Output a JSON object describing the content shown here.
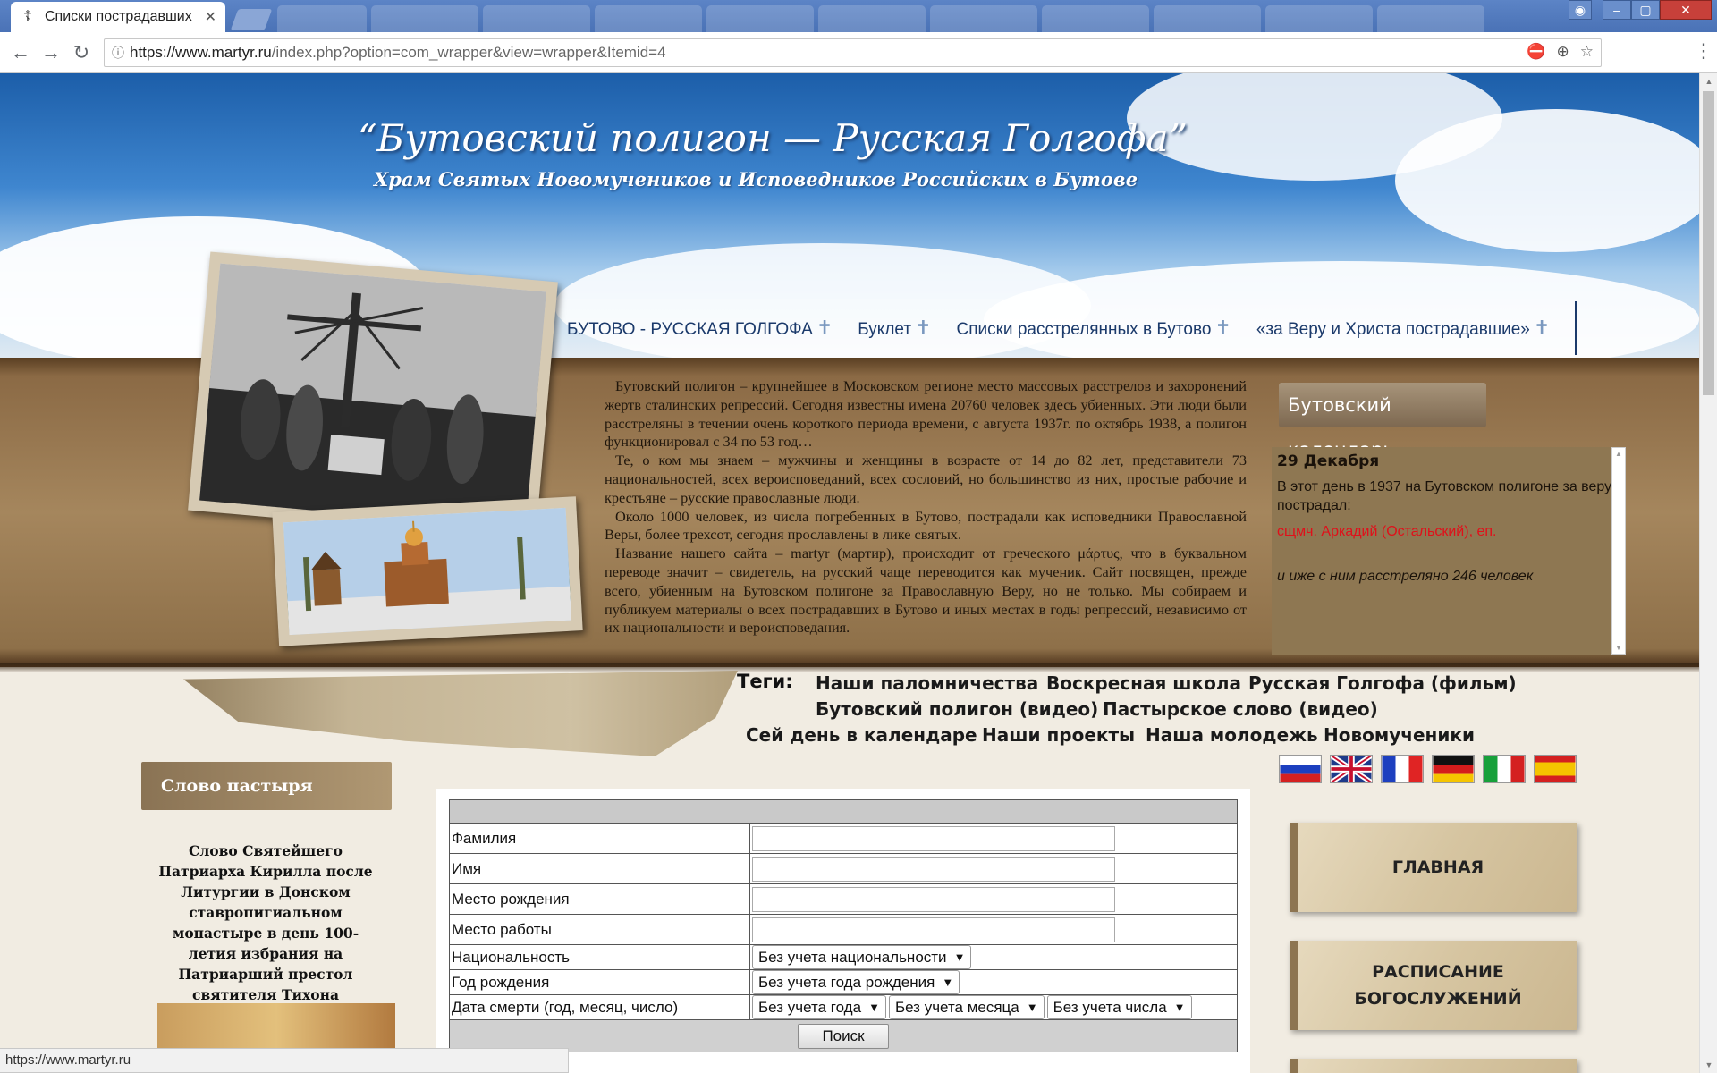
{
  "browser": {
    "tab_title": "Списки пострадавших",
    "url_host": "https://www.martyr.ru",
    "url_path": "/index.php?option=com_wrapper&view=wrapper&Itemid=4",
    "status_url": "https://www.martyr.ru"
  },
  "header": {
    "title": "“Бутовский полигон — Русская Голгофа”",
    "subtitle": "Храм Святых Новомучеников и Исповедников Российских в Бутове"
  },
  "nav": {
    "items": [
      {
        "label": "БУТОВО - РУССКАЯ ГОЛГОФА"
      },
      {
        "label": "Буклет"
      },
      {
        "label": "Списки расстрелянных в Бутово"
      },
      {
        "label": "«за Веру и Христа пострадавшие»"
      }
    ]
  },
  "intro": {
    "paragraphs": [
      "Бутовский полигон – крупнейшее в Московском регионе место массовых расстрелов и захоронений жертв сталинских репрессий. Сегодня известны имена 20760 человек здесь убиенных. Эти люди были расстреляны в течении очень короткого периода времени, с августа 1937г. по октябрь 1938, а полигон функционировал с 34 по 53 год…",
      "Те, о ком мы знаем – мужчины и женщины в возрасте от 14 до 82 лет, представители 73 национальностей, всех вероисповеданий, всех сословий, но большинство из них, простые рабочие и крестьяне – русские православные люди.",
      "Около 1000 человек, из числа погребенных в Бутово, пострадали как исповедники Православной Веры, более трехсот, сегодня прославлены в лике святых.",
      "Название нашего сайта – martyr (мартир), происходит от греческого μάρτυς, что в буквальном переводе значит – свидетель, на русский чаще переводится как мученик. Сайт посвящен, прежде всего, убиенным на Бутовском полигоне за Православную Веру, но не только. Мы собираем и публикуем материалы о всех пострадавших в Бутово и иных местах в годы репрессий, независимо от их национальности и вероисповедания."
    ]
  },
  "calendar": {
    "heading": "Бутовский календарь",
    "date": "29 Декабря",
    "text": "В этот день в 1937 на Бутовском полигоне за веру пострадал:",
    "link": "сщмч. Аркадий (Остальский), еп.",
    "note": "и иже с ним расстреляно 246 человек"
  },
  "tags": {
    "label": "Теги:",
    "items": [
      {
        "label": "Наши паломничества"
      },
      {
        "label": "Воскресная школа"
      },
      {
        "label": "Русская Голгофа (фильм)"
      },
      {
        "label": "Бутовский полигон (видео)"
      },
      {
        "label": "Пастырское слово (видео)"
      },
      {
        "label": "Сей день в календаре"
      },
      {
        "label": "Наши проекты"
      },
      {
        "label": "Наша молодежь"
      },
      {
        "label": "Новомученики"
      }
    ]
  },
  "pastor": {
    "heading": "Слово пастыря",
    "text": "Слово Святейшего Патриарха Кирилла после Литургии в Донском ставропигиальном монастыре в день 100-летия избрания на Патриарший престол святителя Тихона"
  },
  "search_form": {
    "fields": [
      {
        "label": "Фамилия",
        "value": ""
      },
      {
        "label": "Имя",
        "value": ""
      },
      {
        "label": "Место рождения",
        "value": ""
      },
      {
        "label": "Место работы",
        "value": ""
      }
    ],
    "nationality": {
      "label": "Национальность",
      "selected": "Без учета национальности"
    },
    "birth_year": {
      "label": "Год рождения",
      "selected": "Без учета года рождения"
    },
    "death_date": {
      "label": "Дата смерти (год, месяц, число)",
      "year": "Без учета года",
      "month": "Без учета месяца",
      "day": "Без учета числа"
    },
    "submit_label": "Поиск"
  },
  "side_menu": {
    "home": "ГЛАВНАЯ",
    "schedule_line1": "РАСПИСАНИЕ",
    "schedule_line2": "БОГОСЛУЖЕНИЙ"
  },
  "flags": [
    "russian-flag-icon",
    "uk-flag-icon",
    "french-flag-icon",
    "german-flag-icon",
    "italian-flag-icon",
    "spanish-flag-icon"
  ],
  "colors": {
    "nav_text": "#1b3a6b",
    "calendar_link": "#e0101a",
    "banner_brown": "#a5865d"
  }
}
